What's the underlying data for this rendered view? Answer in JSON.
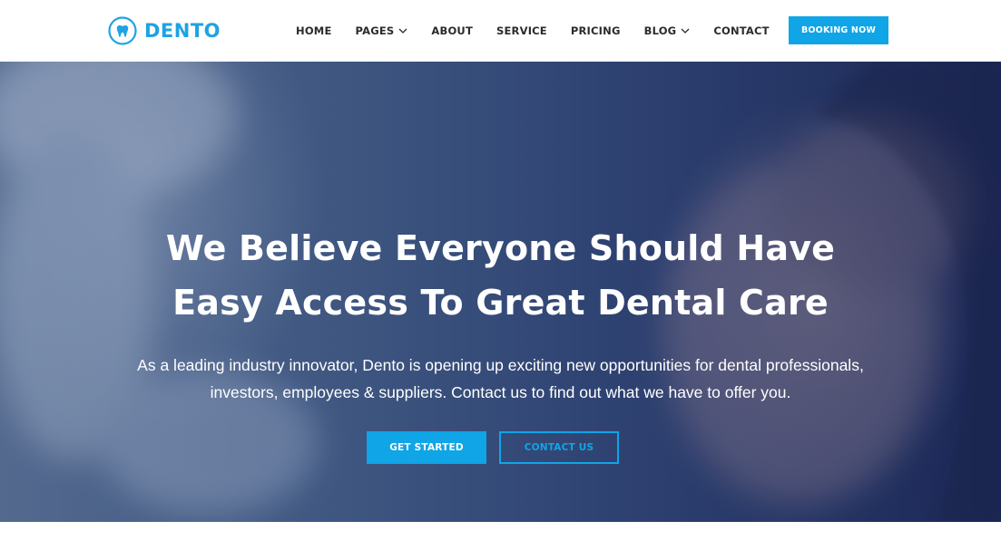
{
  "brand": {
    "name": "DENTO",
    "logo_icon": "tooth-icon",
    "accent_color": "#0fa5e6"
  },
  "nav": {
    "items": [
      {
        "label": "HOME",
        "has_dropdown": false
      },
      {
        "label": "PAGES",
        "has_dropdown": true
      },
      {
        "label": "ABOUT",
        "has_dropdown": false
      },
      {
        "label": "SERVICE",
        "has_dropdown": false
      },
      {
        "label": "PRICING",
        "has_dropdown": false
      },
      {
        "label": "BLOG",
        "has_dropdown": true
      },
      {
        "label": "CONTACT",
        "has_dropdown": false
      }
    ],
    "cta_label": "BOOKING NOW"
  },
  "hero": {
    "title_line1": "We Believe Everyone Should Have",
    "title_line2": "Easy Access To Great Dental Care",
    "subtitle_line1": "As a leading industry innovator, Dento is opening up exciting new opportunities for dental professionals,",
    "subtitle_line2": "investors, employees & suppliers. Contact us to find out what we have to offer you.",
    "primary_button": "GET STARTED",
    "secondary_button": "CONTACT US"
  }
}
